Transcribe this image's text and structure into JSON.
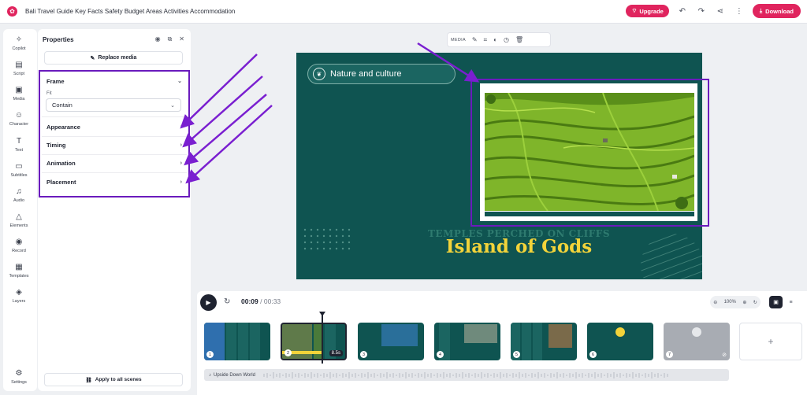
{
  "header": {
    "title": "Bali Travel Guide Key Facts Safety Budget Areas Activities Accommodation",
    "upgrade_label": "Upgrade",
    "download_label": "Download"
  },
  "rail": {
    "items": [
      {
        "label": "Copilot",
        "icon": "sparkle-icon"
      },
      {
        "label": "Script",
        "icon": "script-icon"
      },
      {
        "label": "Media",
        "icon": "image-icon"
      },
      {
        "label": "Character",
        "icon": "person-icon"
      },
      {
        "label": "Text",
        "icon": "text-icon"
      },
      {
        "label": "Subtitles",
        "icon": "subtitles-icon"
      },
      {
        "label": "Audio",
        "icon": "music-icon"
      },
      {
        "label": "Elements",
        "icon": "shapes-icon"
      },
      {
        "label": "Record",
        "icon": "record-icon"
      },
      {
        "label": "Templates",
        "icon": "templates-icon"
      },
      {
        "label": "Layers",
        "icon": "layers-icon"
      }
    ],
    "settings_label": "Settings"
  },
  "properties": {
    "title": "Properties",
    "replace_media": "Replace media",
    "frame_label": "Frame",
    "fit_label": "Fit",
    "fit_value": "Contain",
    "appearance_label": "Appearance",
    "timing_label": "Timing",
    "animation_label": "Animation",
    "placement_label": "Placement",
    "apply_all": "Apply to all scenes"
  },
  "media_toolbar": {
    "label": "MEDIA"
  },
  "canvas": {
    "pill_text": "Nature and culture",
    "sub_headline": "TEMPLES PERCHED ON CLIFFS",
    "headline": "Island of Gods"
  },
  "timeline": {
    "current_time": "00:09",
    "separator": "/",
    "total_time": "00:33",
    "zoom": "100%",
    "clip_duration": "8.5s",
    "audio_track": "Upside Down World",
    "add_label": "+"
  },
  "colors": {
    "accent": "#e0245e",
    "canvas_bg": "#0f5451",
    "headline": "#f2d33a",
    "annotation": "#6a1bbd"
  }
}
